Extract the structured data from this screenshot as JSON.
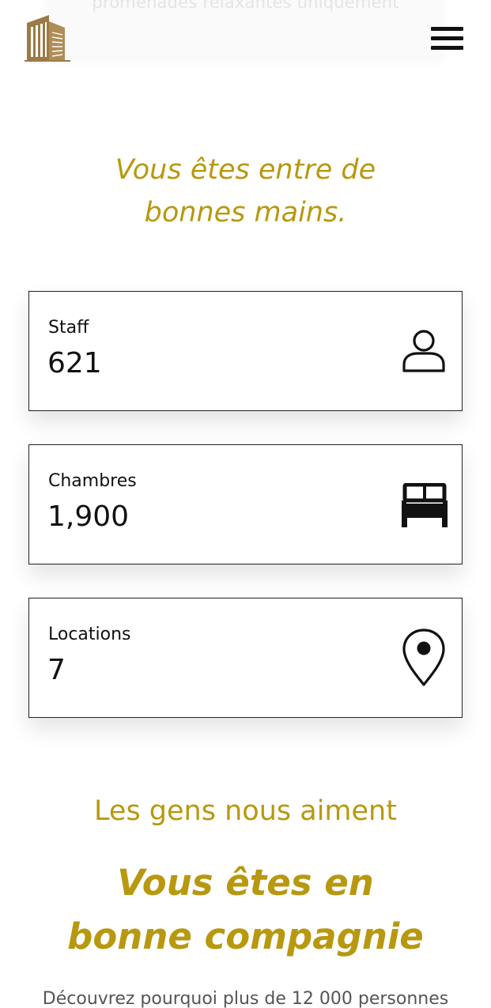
{
  "header": {
    "banner_text": "promenades relaxantes uniquement",
    "logo_icon": "building-logo-icon",
    "menu_icon": "hamburger-menu-icon"
  },
  "trust": {
    "heading": "Vous êtes entre de bonnes mains."
  },
  "stats": [
    {
      "label": "Staff",
      "value": "621",
      "icon": "user-icon"
    },
    {
      "label": "Chambres",
      "value": "1,900",
      "icon": "bed-icon"
    },
    {
      "label": "Locations",
      "value": "7",
      "icon": "location-pin-icon"
    }
  ],
  "testimonials": {
    "subheading": "Les gens nous aiment",
    "heading": "Vous êtes en bonne compagnie",
    "intro": "Découvrez pourquoi plus de 12 000 personnes"
  },
  "colors": {
    "accent": "#b8980f",
    "logo": "#9c7a45",
    "text": "#111111"
  }
}
